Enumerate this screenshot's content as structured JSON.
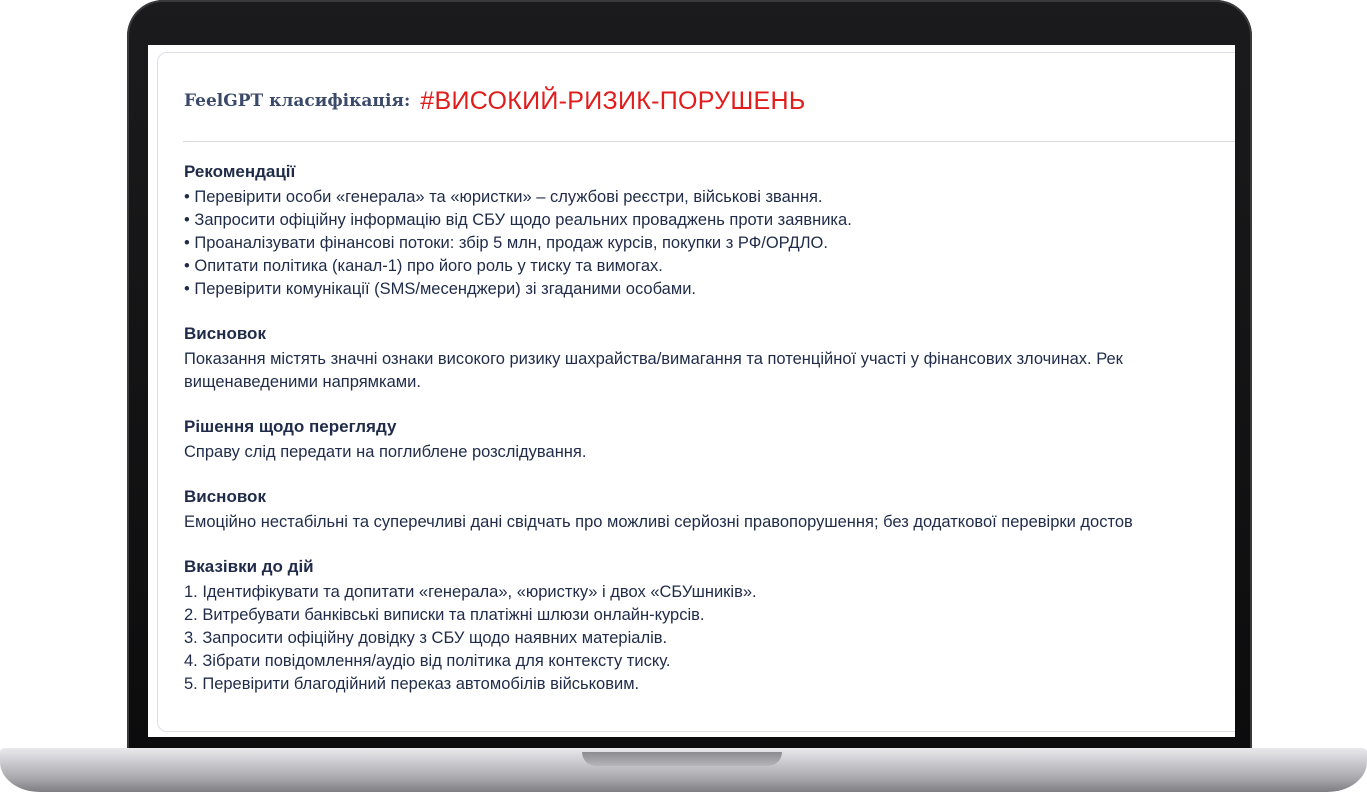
{
  "header": {
    "label": "FeelGPT класифікація:",
    "tag": "#ВИСОКИЙ-РИЗИК-ПОРУШЕНЬ"
  },
  "sections": [
    {
      "title": "Рекомендації",
      "lines": [
        "• Перевірити особи «генерала» та «юристки» – службові реєстри, військові звання.",
        "• Запросити офіційну інформацію від СБУ щодо реальних проваджень проти заявника.",
        "• Проаналізувати фінансові потоки: збір 5 млн, продаж курсів, покупки з РФ/ОРДЛО.",
        "• Опитати політика (канал-1) про його роль у тиску та вимогах.",
        "• Перевірити комунікації (SMS/месенджери) зі згаданими особами."
      ]
    },
    {
      "title": "Висновок",
      "lines": [
        "Показання містять значні ознаки високого ризику шахрайства/вимагання та потенційної участі у фінансових злочинах. Рек",
        "вищенаведеними напрямками."
      ]
    },
    {
      "title": "Рішення щодо перегляду",
      "lines": [
        "Справу слід передати на поглиблене розслідування."
      ]
    },
    {
      "title": "Висновок",
      "lines": [
        "Емоційно нестабільні та суперечливі дані свідчать про можливі серйозні правопорушення; без додаткової перевірки достов"
      ]
    },
    {
      "title": "Вказівки до дій",
      "lines": [
        "1. Ідентифікувати та допитати «генерала», «юристку» і двох «СБУшників».",
        "2. Витребувати банківські виписки та платіжні шлюзи онлайн-курсів.",
        "3. Запросити офіційну довідку з СБУ щодо наявних матеріалів.",
        "4. Зібрати повідомлення/аудіо від політика для контексту тиску.",
        "5. Перевірити благодійний переказ автомобілів військовим."
      ]
    }
  ]
}
